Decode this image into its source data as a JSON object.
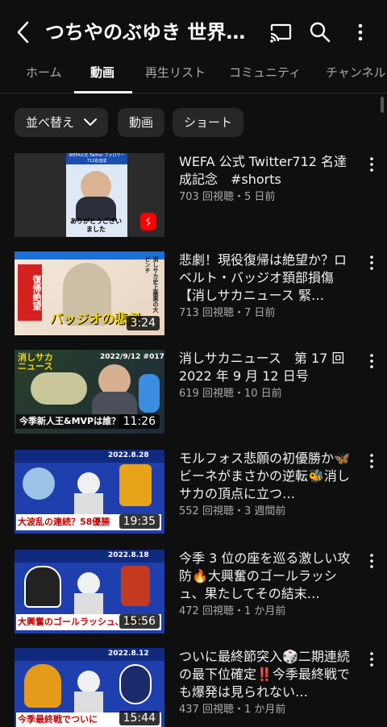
{
  "header": {
    "title": "つちやのぶゆき 世界…"
  },
  "tabs": [
    {
      "label": "ホーム"
    },
    {
      "label": "動画"
    },
    {
      "label": "再生リスト"
    },
    {
      "label": "コミュニティ"
    },
    {
      "label": "チャンネル"
    }
  ],
  "chips": {
    "sort_label": "並べ替え",
    "videos_label": "動画",
    "shorts_label": "ショート"
  },
  "videos": [
    {
      "title": "WEFA 公式 Twitter712 名達成記念　#shorts",
      "meta": "703 回視聴・5 日前",
      "duration": "",
      "thumb_text": "ありがとうございました",
      "thumb_top": "WEFA公式 Twitter フォロワー712名達成"
    },
    {
      "title": "悲劇！現役復帰は絶望か？ロベルト・バッジオ頚部損傷【消しサカニュース 緊…",
      "meta": "713 回視聴・7 日前",
      "duration": "3:24",
      "thumb_text": "バッジオの悲劇",
      "thumb_side": "消しサカ史上最悪の大ピンチ"
    },
    {
      "title": "消しサカニュース　第 17 回 2022 年 9 月 12 日号",
      "meta": "619 回視聴・10 日前",
      "duration": "11:26",
      "thumb_text": "今季新人王&MVPは誰？",
      "thumb_top": "2022/9/12 #017"
    },
    {
      "title": "モルフォス悲願の初優勝か🦋ビーネがまさかの逆転🐝消しサカの頂点に立つ…",
      "meta": "552 回視聴・3 週間前",
      "duration": "19:35",
      "thumb_text": "大波乱の連続？58優勝",
      "thumb_top": "2022.8.28"
    },
    {
      "title": "今季 3 位の座を巡る激しい攻防🔥大興奮のゴールラッシュ、果たしてその結末…",
      "meta": "472 回視聴・1 か月前",
      "duration": "15:56",
      "thumb_text": "大興奮のゴールラッシュ、その",
      "thumb_top": "2022.8.18"
    },
    {
      "title": "ついに最終節突入🎲二期連続の最下位確定‼️今季最終戦でも爆発は見られない…",
      "meta": "437 回視聴・1 か月前",
      "duration": "15:44",
      "thumb_text": "今季最終戦でついに",
      "thumb_top": "2022.8.12"
    }
  ],
  "colors": {
    "background": "#0f0f0f",
    "text": "#f1f1f1",
    "muted": "#aaaaaa",
    "chip": "#272727",
    "shorts_red": "#ff0000"
  }
}
